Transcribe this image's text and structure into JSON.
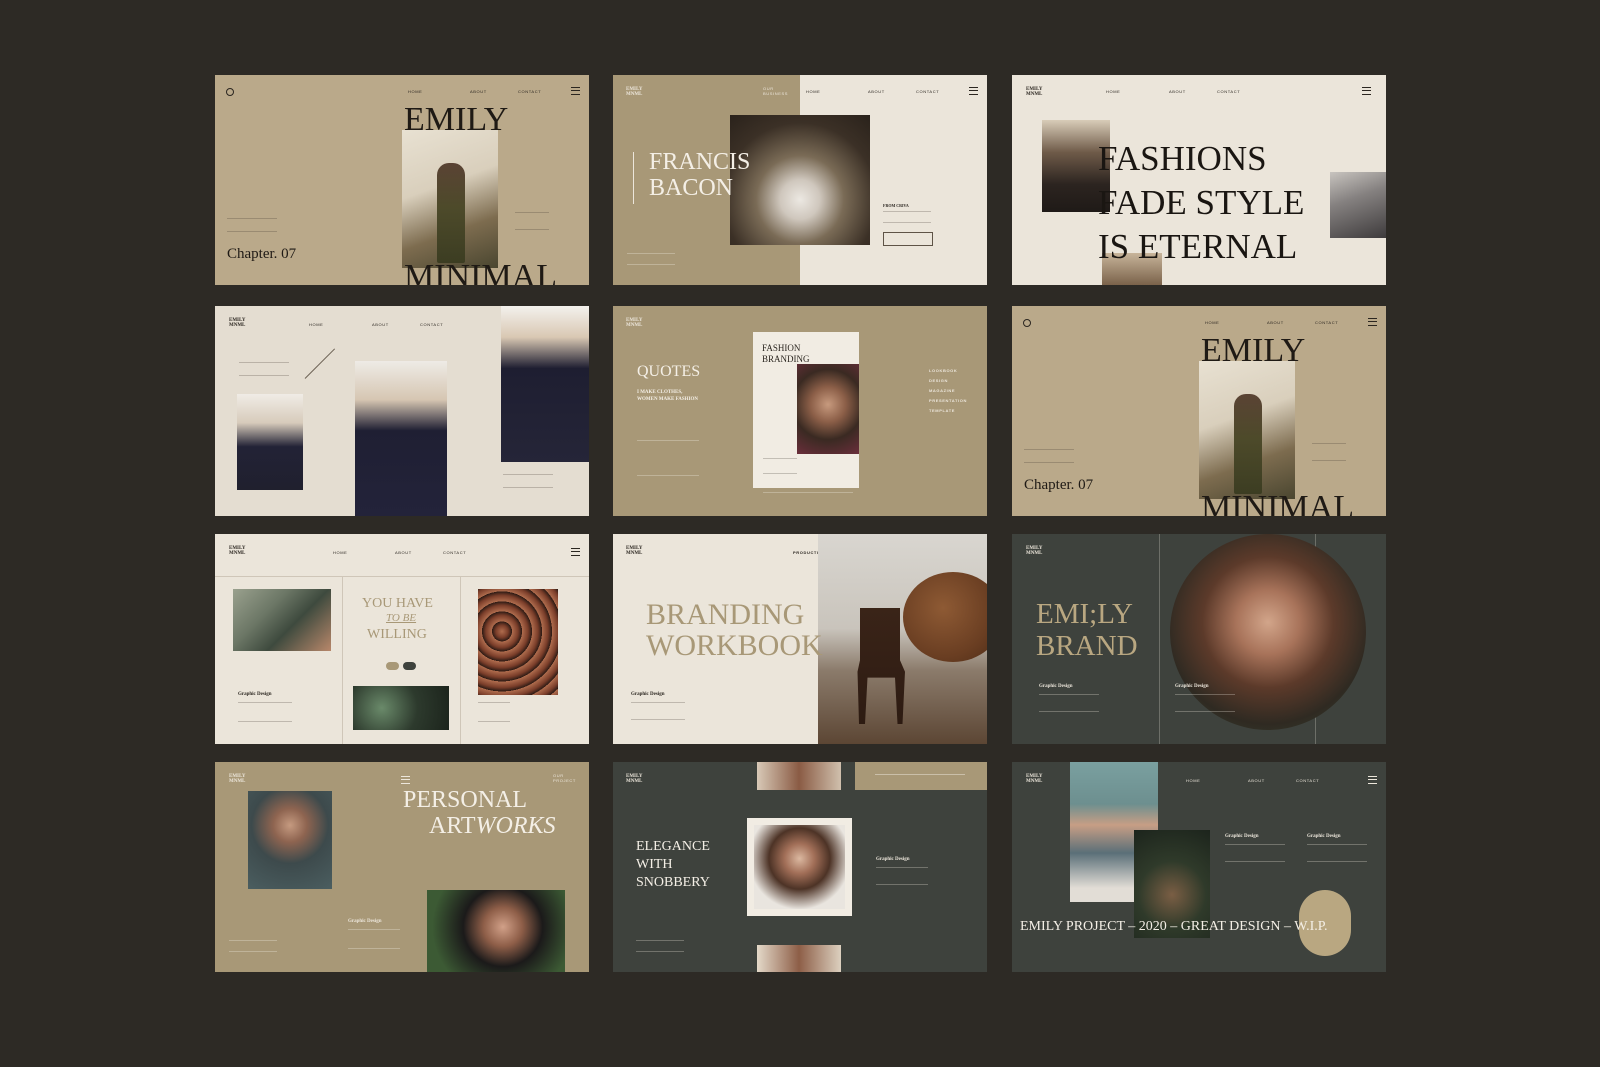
{
  "common": {
    "nav_home": "HOME",
    "nav_about": "ABOUT",
    "nav_contact": "CONTACT",
    "logo_line1": "EMILY",
    "logo_line2": "MNML",
    "graphic_design": "Graphic Design"
  },
  "slide1": {
    "title_top": "EMILY",
    "title_bottom": "MINIMAL",
    "chapter": "Chapter. 07"
  },
  "slide2": {
    "nav_left": "OUR BUSINESS",
    "title_line1": "FRANCIS",
    "title_line2": "BACON",
    "label": "FROM CRIVA"
  },
  "slide3": {
    "line1": "FASHIONS",
    "line2": "FADE STYLE",
    "line3": "IS ETERNAL"
  },
  "slide5": {
    "title": "QUOTES",
    "sub1": "I MAKE CLOTHES,",
    "sub2": "WOMEN MAKE FASHION",
    "card_line1": "FASHION",
    "card_line2": "BRANDING",
    "list": [
      "LOOKBOOK",
      "DESIGN",
      "MAGAZINE",
      "PRESENTATION",
      "TEMPLATE"
    ]
  },
  "slide6": {
    "title_top": "EMILY",
    "title_bottom": "MINIMAL",
    "chapter": "Chapter. 07"
  },
  "slide7": {
    "line1": "YOU HAVE",
    "line2": "TO BE",
    "line3": "WILLING"
  },
  "slide8": {
    "nav": "PRODUCTIVE",
    "line1": "BRANDING",
    "line2": "WORKBOOK"
  },
  "slide9": {
    "line1": "EMI;LY",
    "line2": "BRAND"
  },
  "slide10": {
    "nav_right": "OUR PROJECT",
    "line1": "PERSONAL",
    "line2a": "ART",
    "line2b": "WORKS"
  },
  "slide11": {
    "line1": "ELEGANCE",
    "line2": "WITH",
    "line3": "SNOBBERY"
  },
  "slide12": {
    "footer": "EMILY PROJECT – 2020 – GREAT DESIGN – W.I.P."
  },
  "colors": {
    "background": "#2d2a25",
    "tan": "#baa98a",
    "olive": "#a89877",
    "cream": "#ebe5da",
    "dark": "#3e423d"
  }
}
